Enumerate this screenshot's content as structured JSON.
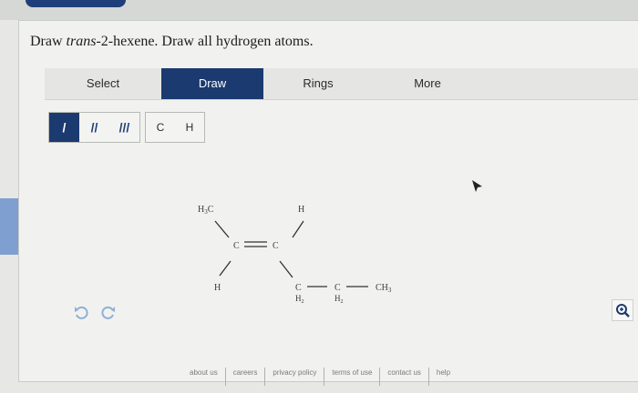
{
  "question": {
    "prefix": "Draw ",
    "compound": "trans",
    "suffix": "-2-hexene. Draw all hydrogen atoms."
  },
  "toolbar": {
    "select": "Select",
    "draw": "Draw",
    "rings": "Rings",
    "more": "More"
  },
  "bond_tools": [
    "/",
    "//",
    "///"
  ],
  "atom_tools": [
    "C",
    "H"
  ],
  "molecule": {
    "h3c": "H",
    "h3c_sub": "3",
    "h3c_c": "C",
    "h_top": "H",
    "c_left": "C",
    "c_right": "C",
    "h_bottom": "H",
    "c_chain1": "C",
    "h2_1": "H",
    "h2_1_sub": "2",
    "c_chain2": "C",
    "h2_2": "H",
    "h2_2_sub": "2",
    "ch3": "CH",
    "ch3_sub": "3"
  },
  "footer": {
    "links": [
      "about us",
      "careers",
      "privacy policy",
      "terms of use",
      "contact us",
      "help"
    ]
  },
  "colors": {
    "accent": "#1b3a70",
    "background": "#f1f2ef"
  },
  "icons": {
    "undo": "undo-icon",
    "redo": "redo-icon",
    "zoom": "zoom-in-icon",
    "cursor": "mouse-cursor-icon"
  }
}
